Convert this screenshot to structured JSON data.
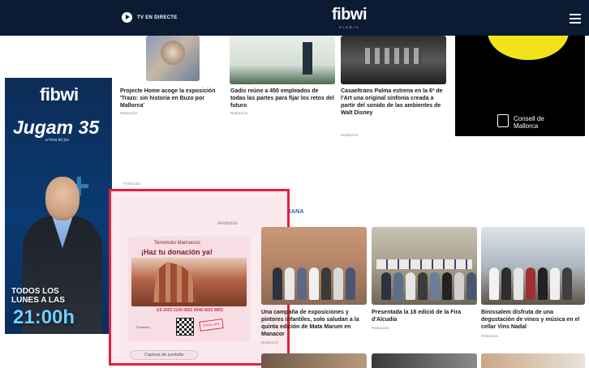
{
  "header": {
    "tv_live_label": "TV EN DIRECTE",
    "logo": "fibwi",
    "logo_sub": "DIARIO"
  },
  "news_top": [
    {
      "title": "Projecte Home acoge la exposición 'Trazo: sin historia en Buzo por Mallorca'",
      "meta": "Redacción"
    },
    {
      "title": "Gadis reúne a 450 empleados de todas las partes para fijar los retos del futuro",
      "meta": "Redacción"
    },
    {
      "title": "Casaeltrans Palma estrena en la 6ª de l'Art una original sinfonía creada a partir del sonido de las ambientes de Walt Disney",
      "meta": "Redacción"
    }
  ],
  "consell_ad": {
    "label": "Consell de Mallorca"
  },
  "side_ad": {
    "logo": "fibwi",
    "title": "Jugam 35",
    "subtitle": "a hora de jos",
    "cta": "TODOS LOS LUNES A LAS",
    "time": "21:00h"
  },
  "section": {
    "small_label": "Publicidad",
    "heading": "PART FORANA"
  },
  "ad_panel": {
    "label": "Anuncios",
    "top_text": "Terremoto Marruecos",
    "headline": "¡Haz tu donación ya!",
    "phone": "ES 2003 2100 0852 9048 0655 0855",
    "org": "Fundació",
    "stamp": "Dona ara",
    "button": "Captura de pantalla"
  },
  "news_bottom": [
    {
      "title": "Una campaña de exposiciones y pintores infantiles, solo saludan a la quinta edición de Mata Marum en Manacor",
      "meta": "Redacción"
    },
    {
      "title": "Presentada la 18 edició de la Fira d'Alcudia",
      "meta": "Redacción"
    },
    {
      "title": "Binissalem disfruta de una degustación de vinos y música en el cellar Vins Nadal",
      "meta": "Redacción"
    }
  ],
  "colors": {
    "navbar": "#0a1b33",
    "highlight_border": "#e0213f",
    "section_blue": "#2a5fa8",
    "side_ad_time": "#6ed0ff"
  }
}
